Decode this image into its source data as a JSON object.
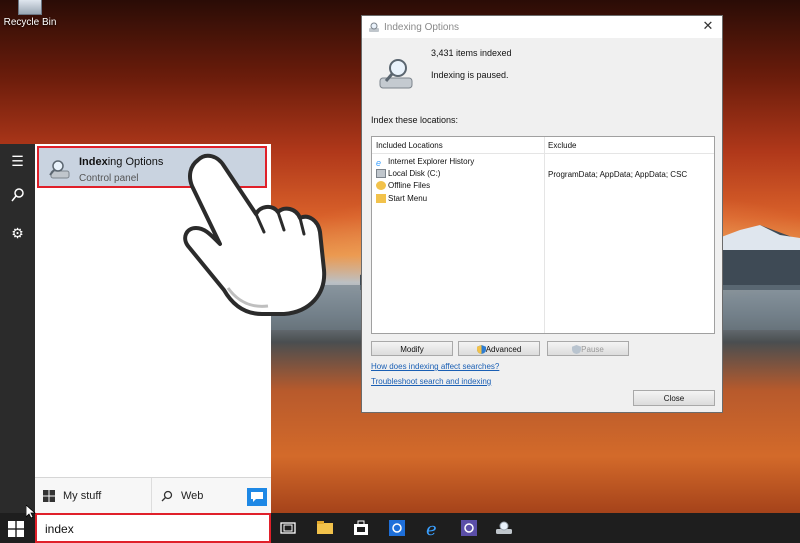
{
  "desktop": {
    "recycle_bin_label": "Recycle Bin"
  },
  "start_menu": {
    "rail_icons": [
      "hamburger-icon",
      "search-icon",
      "gear-icon"
    ],
    "best_match": {
      "title_bold": "Index",
      "title_rest": "ing Options",
      "subtitle": "Control panel",
      "icon": "magnifier-drive-icon"
    },
    "bottom": {
      "my_stuff_label": "My stuff",
      "web_label": "Web"
    }
  },
  "taskbar": {
    "search_value": "index",
    "pinned_icons": [
      "task-view-icon",
      "file-explorer-icon",
      "store-icon",
      "settings-icon",
      "internet-explorer-icon",
      "control-panel-icon",
      "indexing-icon"
    ]
  },
  "dialog": {
    "title": "Indexing Options",
    "items_indexed": "3,431 items indexed",
    "status": "Indexing is paused.",
    "locations_heading": "Index these locations:",
    "columns": [
      "Included Locations",
      "Exclude"
    ],
    "locations": [
      {
        "name": "Internet Explorer History",
        "exclude": ""
      },
      {
        "name": "Local Disk (C:)",
        "exclude": "ProgramData; AppData; AppData; CSC"
      },
      {
        "name": "Offline Files",
        "exclude": ""
      },
      {
        "name": "Start Menu",
        "exclude": ""
      }
    ],
    "buttons": {
      "modify": "Modify",
      "advanced": "Advanced",
      "pause": "Pause",
      "close": "Close"
    },
    "links": {
      "how": "How does indexing affect searches?",
      "troubleshoot": "Troubleshoot search and indexing"
    }
  },
  "colors": {
    "highlight_border": "#e0202a",
    "result_bg": "#c9d3e0",
    "taskbar": "#1e1e1e",
    "link": "#1a5fb4"
  }
}
